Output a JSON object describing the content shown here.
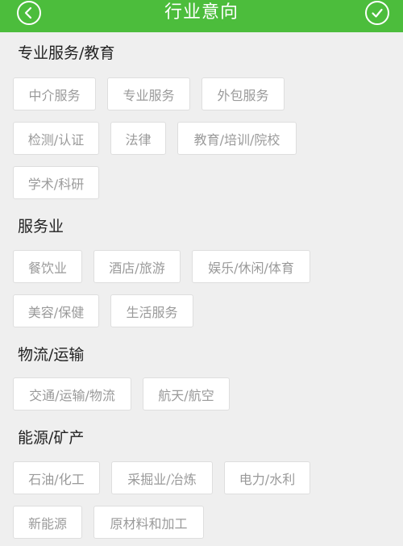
{
  "header": {
    "title": "行业意向",
    "accent_color": "#4cbd3c",
    "back_icon": "chevron-left-icon",
    "confirm_icon": "check-icon"
  },
  "sections": [
    {
      "title": "专业服务/教育",
      "items": [
        "中介服务",
        "专业服务",
        "外包服务",
        "检测/认证",
        "法律",
        "教育/培训/院校",
        "学术/科研"
      ]
    },
    {
      "title": "服务业",
      "items": [
        "餐饮业",
        "酒店/旅游",
        "娱乐/休闲/体育",
        "美容/保健",
        "生活服务"
      ]
    },
    {
      "title": "物流/运输",
      "items": [
        "交通/运输/物流",
        "航天/航空"
      ]
    },
    {
      "title": "能源/矿产",
      "items": [
        "石油/化工",
        "采掘业/冶炼",
        "电力/水利",
        "新能源",
        "原材料和加工"
      ]
    }
  ]
}
